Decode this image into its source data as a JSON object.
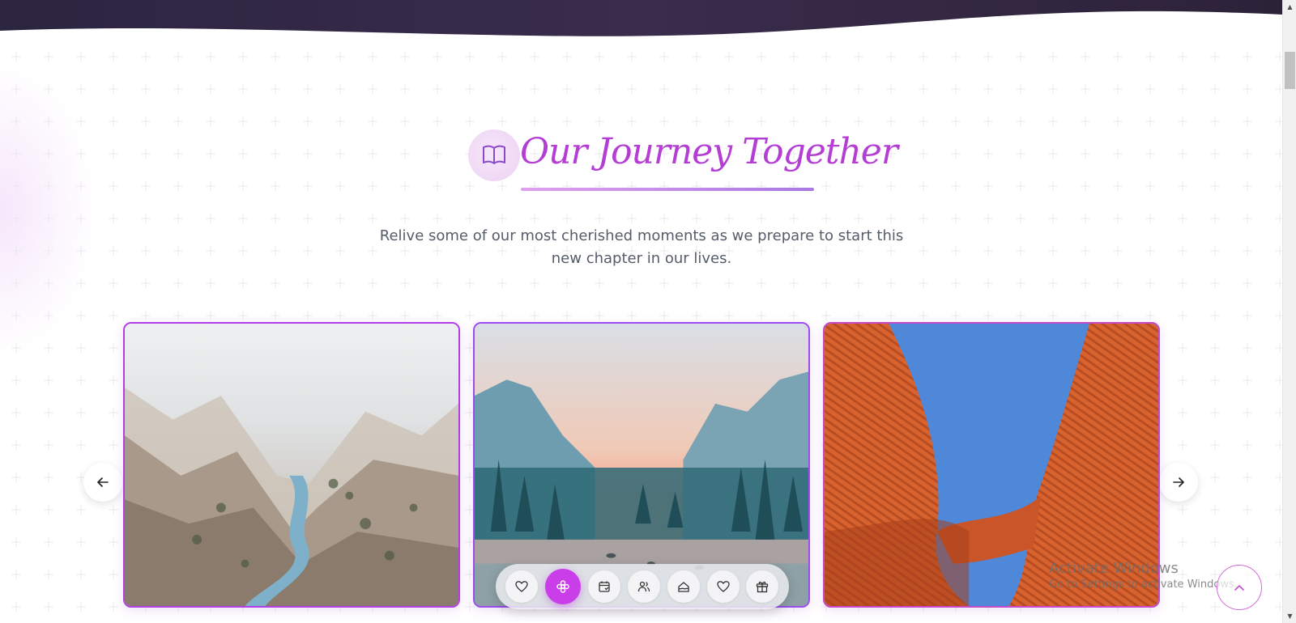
{
  "section": {
    "title": "Our Journey Together",
    "subtitle": "Relive some of our most cherished moments as we prepare to start this new chapter in our lives."
  },
  "colors": {
    "accent": "#b43ed3",
    "card_border": "#b33de6",
    "dock_active": "#c93ee8",
    "header_dark": "#2a1f3d"
  },
  "gallery": {
    "prev_icon": "arrow-left-icon",
    "next_icon": "arrow-right-icon",
    "cards": [
      {
        "name": "misty-canyon-photo"
      },
      {
        "name": "valley-sunset-photo"
      },
      {
        "name": "orange-architecture-photo"
      }
    ]
  },
  "dock": {
    "items": [
      {
        "icon": "heart-icon",
        "active": false
      },
      {
        "icon": "flower-icon",
        "active": true
      },
      {
        "icon": "calendar-icon",
        "active": false
      },
      {
        "icon": "people-icon",
        "active": false
      },
      {
        "icon": "cake-icon",
        "active": false
      },
      {
        "icon": "heart-icon",
        "active": false
      },
      {
        "icon": "gift-icon",
        "active": false
      }
    ]
  },
  "watermark": {
    "title": "Activate Windows",
    "subtitle": "Go to Settings to activate Windows."
  },
  "back_to_top": {
    "icon": "chevron-up-icon"
  }
}
